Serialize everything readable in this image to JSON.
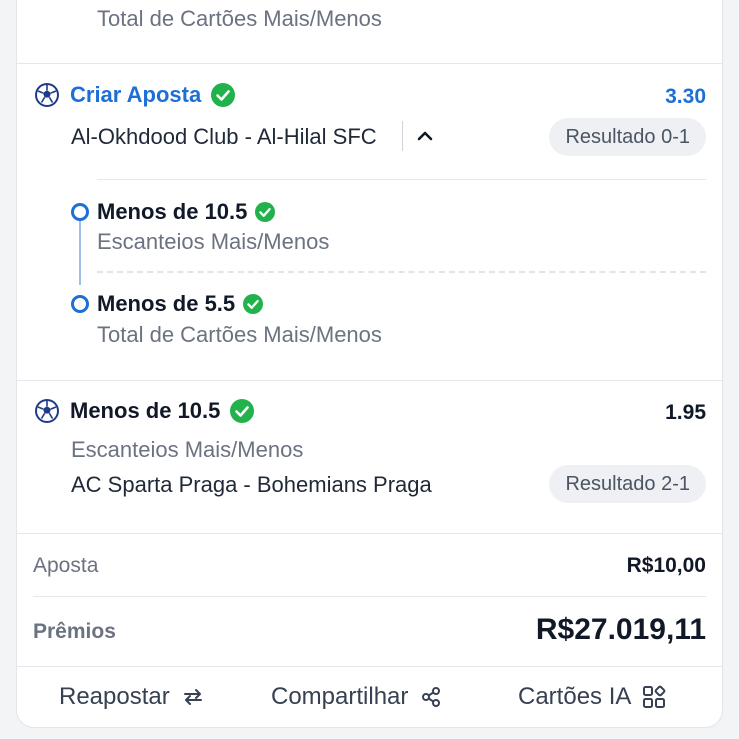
{
  "top_leg": {
    "subtitle": "Total de Cartões Mais/Menos"
  },
  "bet1": {
    "title": "Criar Aposta",
    "odds": "3.30",
    "match": "Al-Okhdood Club - Al-Hilal SFC",
    "result": "Resultado 0-1",
    "legs": [
      {
        "title": "Menos de 10.5",
        "subtitle": "Escanteios Mais/Menos"
      },
      {
        "title": "Menos de 5.5",
        "subtitle": "Total de Cartões Mais/Menos"
      }
    ]
  },
  "bet2": {
    "title": "Menos de 10.5",
    "odds": "1.95",
    "market": "Escanteios Mais/Menos",
    "match": "AC Sparta Praga - Bohemians Praga",
    "result": "Resultado 2-1"
  },
  "summary": {
    "stake_label": "Aposta",
    "stake_value": "R$10,00",
    "prize_label": "Prêmios",
    "prize_value": "R$27.019,11"
  },
  "footer": {
    "rebet_label": "Reapostar",
    "share_label": "Compartilhar",
    "cards_label": "Cartões IA"
  },
  "colors": {
    "accent": "#1d6fd6",
    "success": "#22b24c",
    "pill_bg": "#eef0f3"
  },
  "icons": [
    "soccer-ball-icon",
    "check-circle-icon",
    "chevron-up-icon",
    "repeat-icon",
    "share-icon",
    "grid-icon"
  ]
}
